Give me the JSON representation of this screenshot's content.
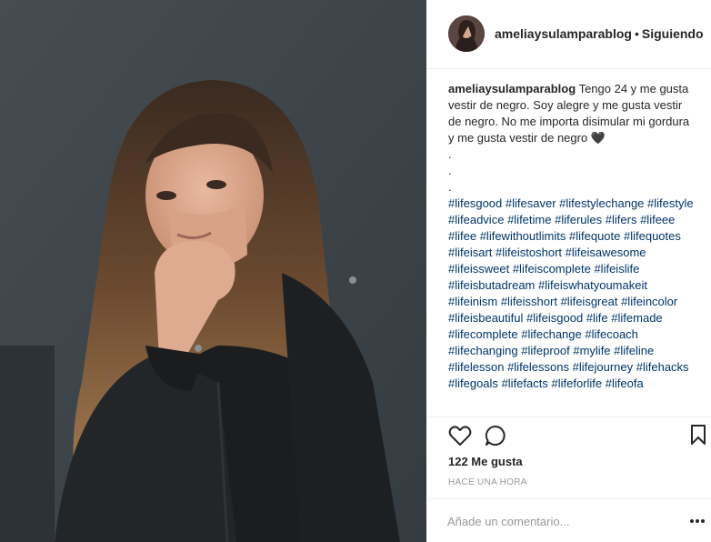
{
  "post": {
    "username": "ameliaysulamparablog",
    "separator": "•",
    "follow_status": "Siguiendo",
    "caption_text": "Tengo 24 y me gusta vestir de negro. Soy alegre y me gusta vestir de negro. No me importa disimular mi gordura y me gusta vestir de negro 🖤",
    "dots": [
      ".",
      ".",
      "."
    ],
    "hashtags": [
      "#lifesgood",
      "#lifesaver",
      "#lifestylechange",
      "#lifestyle",
      "#lifeadvice",
      "#lifetime",
      "#liferules",
      "#lifers",
      "#lifeee",
      "#lifee",
      "#lifewithoutlimits",
      "#lifequote",
      "#lifequotes",
      "#lifeisart",
      "#lifeistoshort",
      "#lifeisawesome",
      "#lifeissweet",
      "#lifeiscomplete",
      "#lifeislife",
      "#lifeisbutadream",
      "#lifeiswhatyoumakeit",
      "#lifeinism",
      "#lifeisshort",
      "#lifeisgreat",
      "#lifeincolor",
      "#lifeisbeautiful",
      "#lifeisgood",
      "#life",
      "#lifemade",
      "#lifecomplete",
      "#lifechange",
      "#lifecoach",
      "#lifechanging",
      "#lifeproof",
      "#mylife",
      "#lifeline",
      "#lifelesson",
      "#lifelessons",
      "#lifejourney",
      "#lifehacks",
      "#lifegoals",
      "#lifefacts",
      "#lifeforlife",
      "#lifeofa"
    ],
    "likes": "122 Me gusta",
    "timestamp": "HACE UNA HORA",
    "comment_placeholder": "Añade un comentario...",
    "icons": {
      "like": "heart-icon",
      "comment": "comment-icon",
      "save": "bookmark-icon",
      "more": "more-options-icon"
    }
  }
}
